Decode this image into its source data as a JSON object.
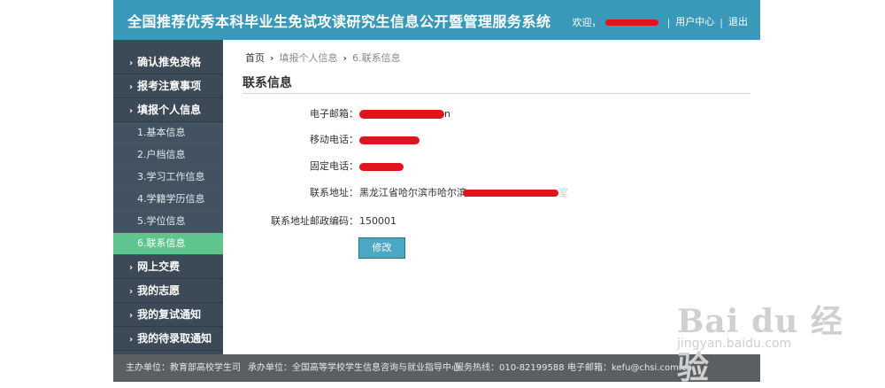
{
  "header": {
    "title": "全国推荐优秀本科毕业生免试攻读研究生信息公开暨管理服务系统",
    "welcome": "欢迎，",
    "separator": "|",
    "user_center": "用户中心",
    "logout": "退出"
  },
  "sidebar": {
    "items": [
      {
        "label": "确认推免资格"
      },
      {
        "label": "报考注意事项"
      },
      {
        "label": "填报个人信息"
      }
    ],
    "sub_items": [
      {
        "label": "1.基本信息"
      },
      {
        "label": "2.户档信息"
      },
      {
        "label": "3.学习工作信息"
      },
      {
        "label": "4.学籍学历信息"
      },
      {
        "label": "5.学位信息"
      },
      {
        "label": "6.联系信息"
      }
    ],
    "items_after": [
      {
        "label": "网上交费"
      },
      {
        "label": "我的志愿"
      },
      {
        "label": "我的复试通知"
      },
      {
        "label": "我的待录取通知"
      }
    ],
    "chevron": "›"
  },
  "breadcrumb": {
    "home": "首页",
    "arrow": "›",
    "level2": "填报个人信息",
    "level3": "6.联系信息"
  },
  "section": {
    "title": "联系信息"
  },
  "fields": {
    "email_label": "电子邮箱：",
    "email_suffix": "n",
    "mobile_label": "移动电话：",
    "phone_label": "固定电话：",
    "address_label": "联系地址：",
    "address_value": "黑龙江省哈尔滨市哈尔滨",
    "address_suffix": "室",
    "postcode_label": "联系地址邮政编码：",
    "postcode_value": "150001"
  },
  "buttons": {
    "edit": "修改"
  },
  "footer": {
    "host": "主办单位：教育部高校学生司",
    "organizer": "承办单位：全国高等学校学生信息咨询与就业指导中心",
    "hotline": "服务热线：010-82199588",
    "email": "电子邮箱：kefu@chsi.com.cn"
  },
  "watermark": {
    "logo": "Bai du 经验",
    "url": "jingyan.baidu.com"
  },
  "colors": {
    "header_bg": "#3a98b9",
    "sidebar_bg": "#3c4a57",
    "active_item": "#5ec58f",
    "redaction": "#e0141e",
    "footer_bg": "#5a5f63"
  }
}
